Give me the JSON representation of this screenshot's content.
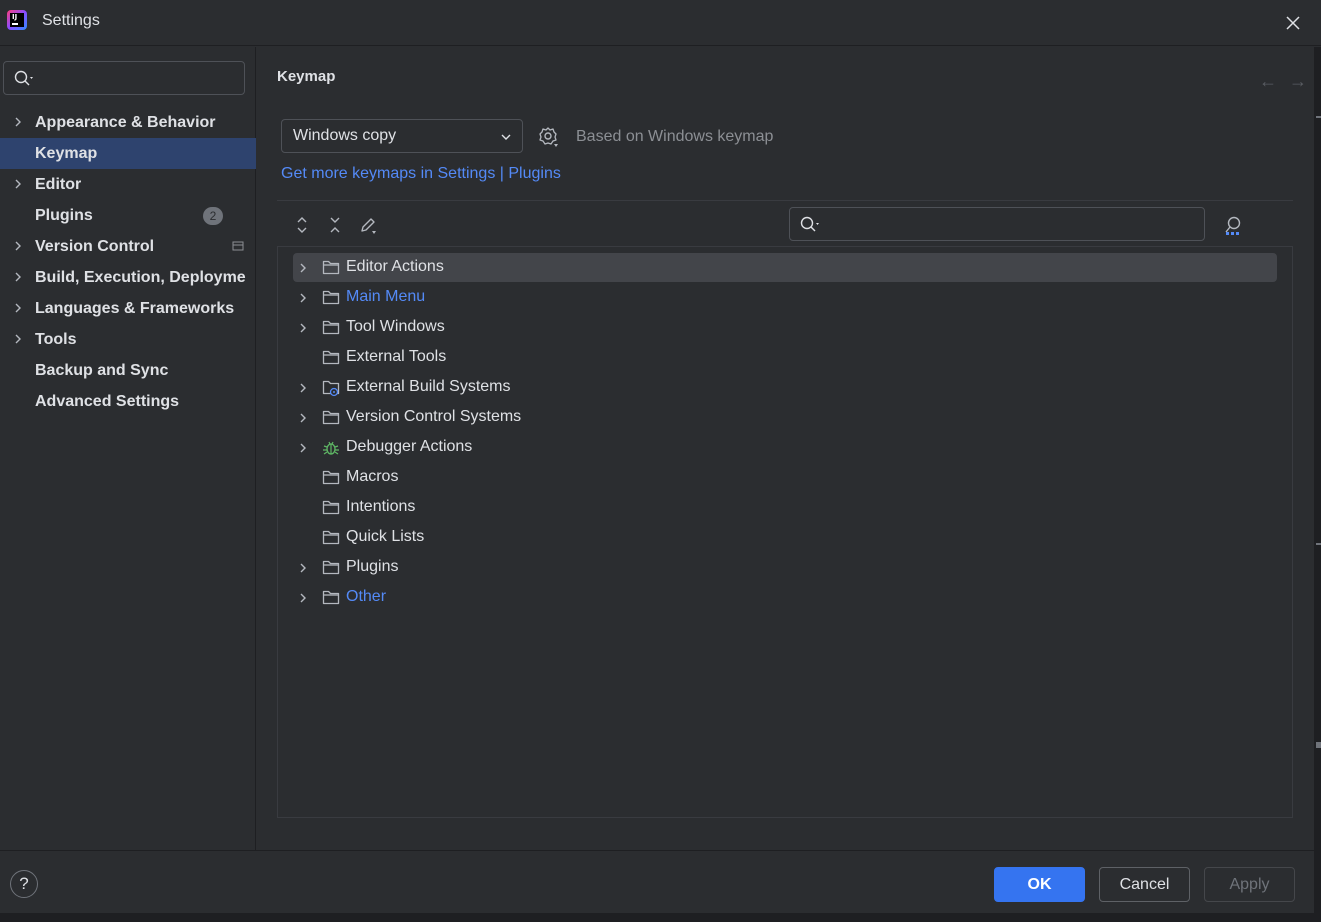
{
  "window": {
    "title": "Settings"
  },
  "sidebar": {
    "search_placeholder": "",
    "items": [
      {
        "label": "Appearance & Behavior"
      },
      {
        "label": "Keymap"
      },
      {
        "label": "Editor"
      },
      {
        "label": "Plugins",
        "badge": "2"
      },
      {
        "label": "Version Control"
      },
      {
        "label": "Build, Execution, Deployme"
      },
      {
        "label": "Languages & Frameworks"
      },
      {
        "label": "Tools"
      },
      {
        "label": "Backup and Sync"
      },
      {
        "label": "Advanced Settings"
      }
    ]
  },
  "main": {
    "title": "Keymap",
    "keymap_select": {
      "value": "Windows copy"
    },
    "based_on": "Based on Windows keymap",
    "plugins_link": "Get more keymaps in Settings | Plugins",
    "action_search_placeholder": "",
    "tree": [
      {
        "label": "Editor Actions",
        "modified": false
      },
      {
        "label": "Main Menu",
        "modified": true
      },
      {
        "label": "Tool Windows",
        "modified": false
      },
      {
        "label": "External Tools",
        "modified": false
      },
      {
        "label": "External Build Systems",
        "modified": false
      },
      {
        "label": "Version Control Systems",
        "modified": false
      },
      {
        "label": "Debugger Actions",
        "modified": false
      },
      {
        "label": "Macros",
        "modified": false
      },
      {
        "label": "Intentions",
        "modified": false
      },
      {
        "label": "Quick Lists",
        "modified": false
      },
      {
        "label": "Plugins",
        "modified": false
      },
      {
        "label": "Other",
        "modified": true
      }
    ]
  },
  "footer": {
    "help": "?",
    "ok": "OK",
    "cancel": "Cancel",
    "apply": "Apply"
  },
  "colors": {
    "background": "#2b2d30",
    "selection": "#2e436e",
    "accent": "#3574f0",
    "link": "#548af7",
    "text": "#dfe1e5",
    "muted": "#8c8f94"
  }
}
